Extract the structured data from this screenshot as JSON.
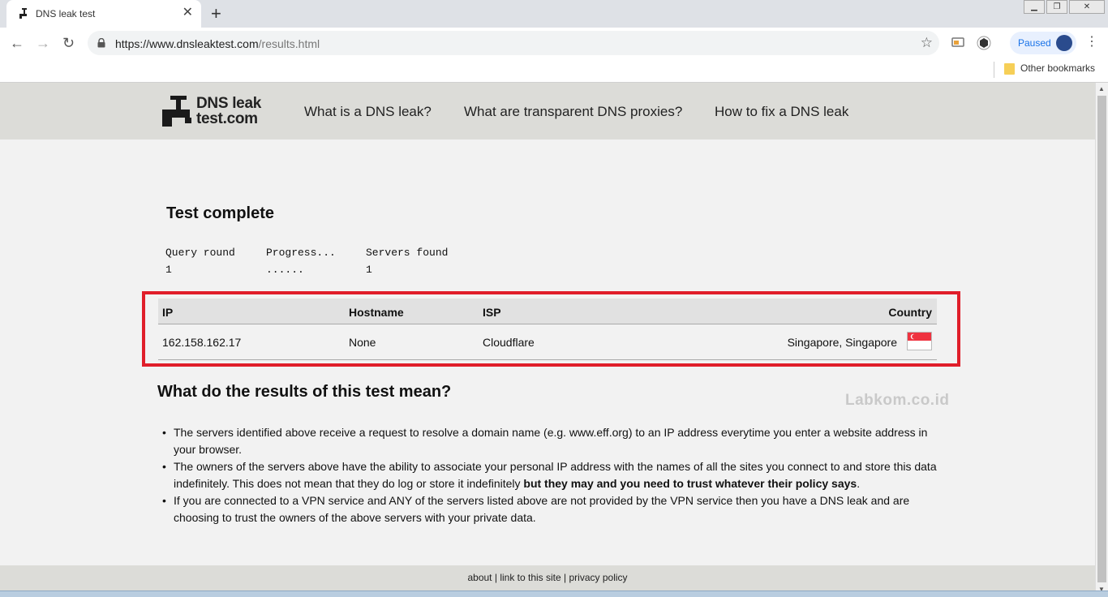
{
  "browser": {
    "tab_title": "DNS leak test",
    "tab_close": "✕",
    "new_tab": "+",
    "url_host": "https://www.dnsleaktest.com",
    "url_path": "/results.html",
    "profile_label": "Paused",
    "bookmarks_label": "Other bookmarks",
    "icons": [
      "back-icon",
      "forward-icon",
      "reload-icon",
      "lock-icon",
      "star-icon",
      "cast-icon",
      "extension-icon",
      "menu-icon",
      "folder-icon"
    ]
  },
  "site": {
    "logo_line1": "DNS leak",
    "logo_line2": "test.com",
    "nav": [
      "What is a DNS leak?",
      "What are transparent DNS proxies?",
      "How to fix a DNS leak"
    ]
  },
  "test": {
    "title": "Test complete",
    "query_headers": [
      "Query round",
      "Progress...",
      "Servers found"
    ],
    "query_values": [
      "1",
      "......",
      "1"
    ]
  },
  "results": {
    "headers": [
      "IP",
      "Hostname",
      "ISP",
      "Country"
    ],
    "rows": [
      {
        "ip": "162.158.162.17",
        "hostname": "None",
        "isp": "Cloudflare",
        "country": "Singapore, Singapore"
      }
    ],
    "highlight_color": "#e01e2a"
  },
  "explanation": {
    "title": "What do the results of this test mean?",
    "watermark": "Labkom.co.id",
    "bullet1": "The servers identified above receive a request to resolve a domain name (e.g. www.eff.org) to an IP address everytime you enter a website address in your browser.",
    "bullet2_start": "The owners of the servers above have the ability to associate your personal IP address with the names of all the sites you connect to and store this data indefinitely. This does not mean that they do log or store it indefinitely ",
    "bullet2_bold": "but they may and you need to trust whatever their policy says",
    "bullet2_end": ".",
    "bullet3": "If you are connected to a VPN service and ANY of the servers listed above are not provided by the VPN service then you have a DNS leak and are choosing to trust the owners of the above servers with your private data."
  },
  "footer": {
    "about": "about",
    "link": "link to this site",
    "privacy": "privacy policy",
    "sep": "|"
  }
}
